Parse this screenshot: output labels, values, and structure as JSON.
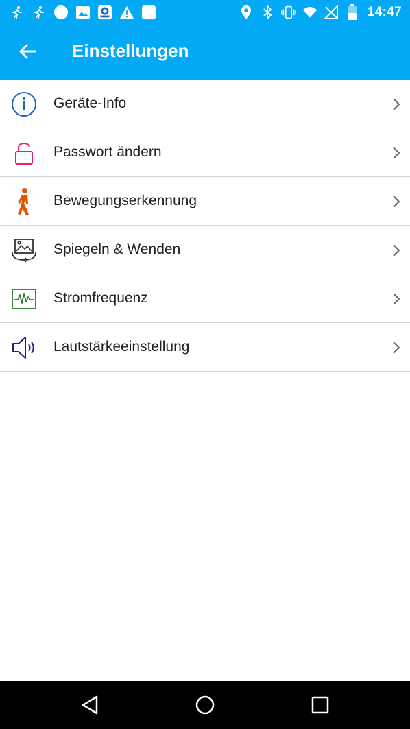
{
  "status_bar": {
    "time": "14:47",
    "left_icons": [
      "runner-icon",
      "runner-icon",
      "circle-icon",
      "image-icon",
      "app-icon",
      "warning-icon",
      "square-icon"
    ],
    "right_icons": [
      "location-icon",
      "bluetooth-icon",
      "vibrate-icon",
      "wifi-icon",
      "no-signal-icon",
      "battery-icon"
    ]
  },
  "app_bar": {
    "title": "Einstellungen",
    "back_icon": "arrow-left-icon",
    "color": "#03a9f4"
  },
  "settings": {
    "items": [
      {
        "label": "Geräte-Info",
        "icon": "info-icon",
        "color": "#1565c0"
      },
      {
        "label": "Passwort ändern",
        "icon": "lock-icon",
        "color": "#e91e63"
      },
      {
        "label": "Bewegungserkennung",
        "icon": "walking-person-icon",
        "color": "#e65100"
      },
      {
        "label": "Spiegeln & Wenden",
        "icon": "mirror-image-icon",
        "color": "#333333"
      },
      {
        "label": "Stromfrequenz",
        "icon": "frequency-wave-icon",
        "color": "#2e7d32"
      },
      {
        "label": "Lautstärkeeinstellung",
        "icon": "speaker-icon",
        "color": "#1a237e"
      }
    ],
    "chevron_icon": "chevron-right-icon"
  },
  "nav_bar": {
    "buttons": [
      "back-triangle-icon",
      "home-circle-icon",
      "recents-square-icon"
    ]
  }
}
